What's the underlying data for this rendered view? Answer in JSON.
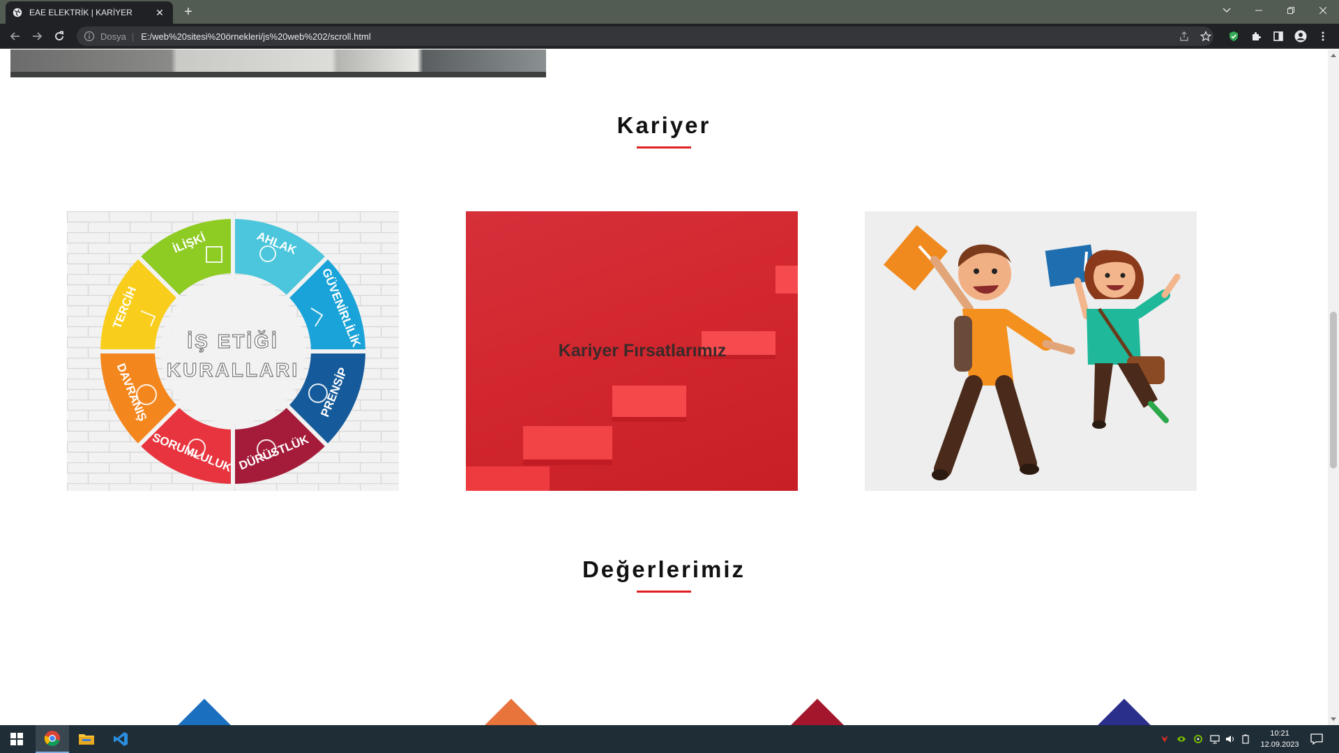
{
  "browser": {
    "tab_title": "EAE ELEKTRİK | KARİYER",
    "omnibox_scheme": "Dosya",
    "url": "E:/web%20sitesi%20örnekleri/js%20web%202/scroll.html"
  },
  "page": {
    "kariyer_title": "Kariyer",
    "kariyer_cards": [
      {
        "name": "is-etigi-kurallari-image",
        "center_title": "İŞ ETİĞİ",
        "center_sub": "KURALLARI",
        "segments": [
          "İLİŞKİ",
          "AHLAK",
          "GÜVENİRLİLİK",
          "PRENSİP",
          "DÜRÜSTLÜK",
          "SORUMLULUK",
          "DAVRANIŞ",
          "TERCİH"
        ]
      },
      {
        "name": "kariyer-firsatlari-card",
        "label": "Kariyer Fırsatlarımız"
      },
      {
        "name": "students-jumping-image"
      }
    ],
    "degerlerimiz_title": "Değerlerimiz",
    "value_icon_colors": [
      "#1b6fbf",
      "#e8743c",
      "#a3162c",
      "#2b2f8c"
    ]
  },
  "taskbar": {
    "time": "10:21",
    "date": "12.09.2023"
  },
  "colors": {
    "accent_red": "#e02020",
    "tab_bar": "#525c52",
    "toolbar": "#202124",
    "taskbar": "#1f2d36"
  }
}
